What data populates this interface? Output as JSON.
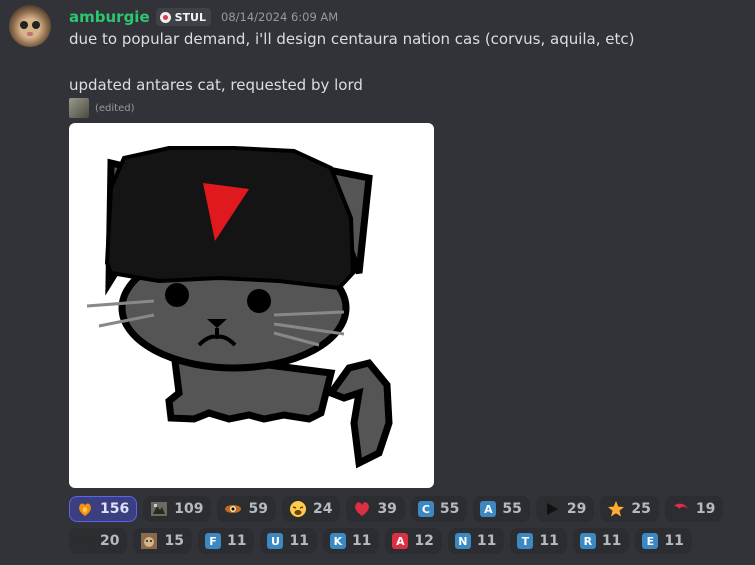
{
  "message": {
    "username": "amburgie",
    "tag": "STUL",
    "timestamp": "08/14/2024 6:09 AM",
    "text_line1": "due to popular demand, i'll design centaura nation cas (corvus, aquila, etc)",
    "text_line2": "updated antares cat, requested by lord",
    "edited_label": "(edited)"
  },
  "colors": {
    "username": "#2dc770",
    "background": "#313338",
    "reaction_bg": "#2b2d31",
    "reaction_active_bg": "#3b3f80",
    "letter_blue": "#3b88c3",
    "letter_red": "#dd2e44"
  },
  "reactions": [
    {
      "icon": "flame-heart-icon",
      "count": "156",
      "active": true
    },
    {
      "icon": "cat-image-icon",
      "count": "109"
    },
    {
      "icon": "eye-icon",
      "count": "59"
    },
    {
      "icon": "tired-face-icon",
      "count": "24"
    },
    {
      "icon": "heart-icon",
      "count": "39"
    },
    {
      "letter": "C",
      "count": "55"
    },
    {
      "letter": "A",
      "count": "55"
    },
    {
      "icon": "play-arrow-icon",
      "count": "29"
    },
    {
      "icon": "star-icon",
      "count": "25"
    },
    {
      "icon": "red-swoosh-icon",
      "count": "19"
    },
    {
      "icon": "dark-swoosh-icon",
      "count": "20"
    },
    {
      "icon": "cat-photo-icon",
      "count": "15"
    },
    {
      "letter": "F",
      "count": "11"
    },
    {
      "letter": "U",
      "count": "11"
    },
    {
      "letter": "K",
      "count": "11"
    },
    {
      "letter": "A",
      "count": "12",
      "red": true
    },
    {
      "letter": "N",
      "count": "11"
    },
    {
      "letter": "T",
      "count": "11"
    },
    {
      "letter": "R",
      "count": "11"
    },
    {
      "letter": "E",
      "count": "11"
    }
  ]
}
